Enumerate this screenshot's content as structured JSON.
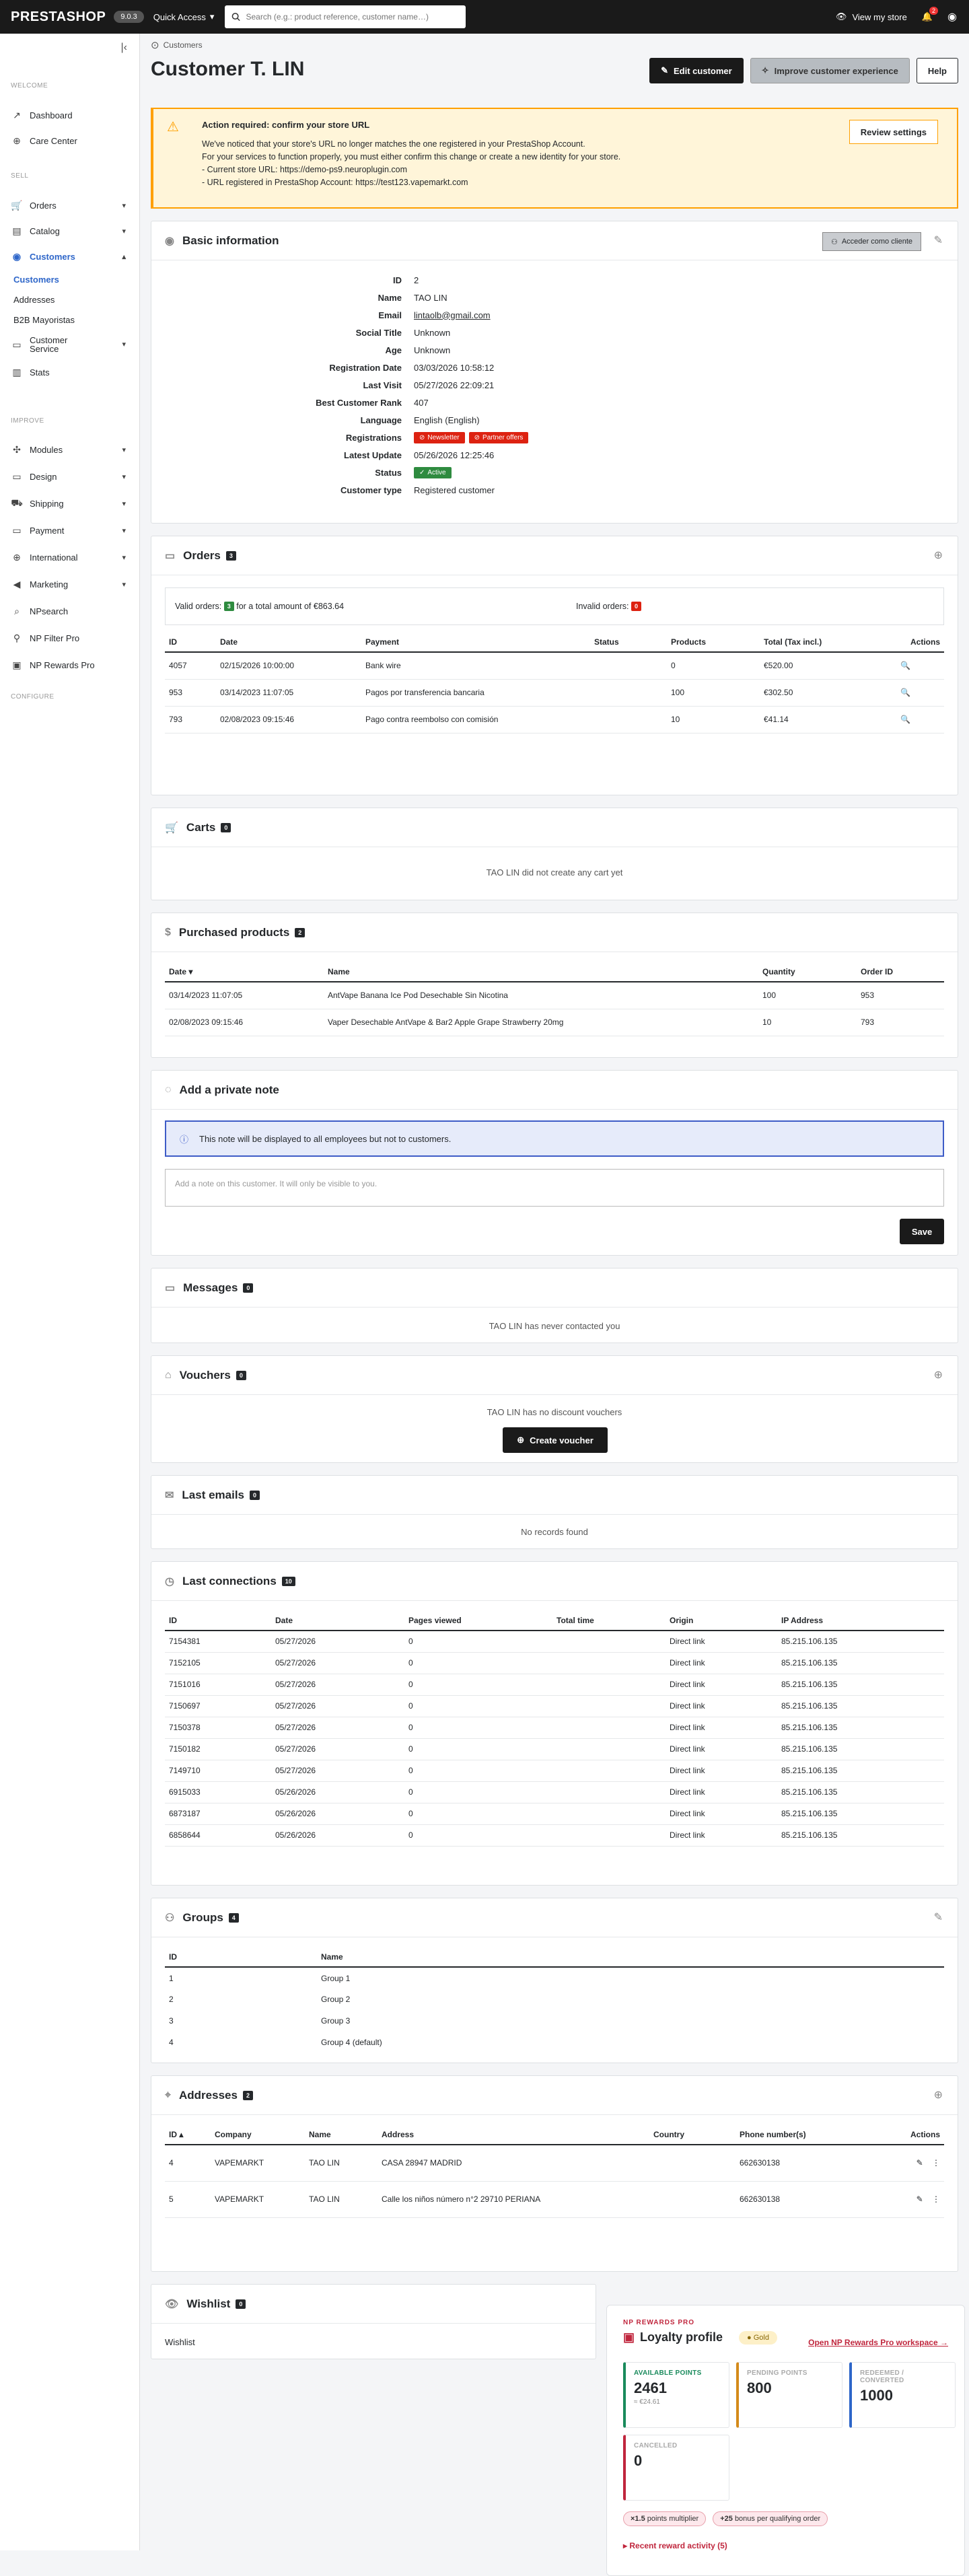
{
  "app": {
    "logo": "PRESTASHOP",
    "version": "9.0.3",
    "quick_access": "Quick Access",
    "search_placeholder": "Search (e.g.: product reference, customer name…)",
    "view_store": "View my store",
    "notif_count": "2"
  },
  "sidebar": {
    "sections": {
      "welcome": "WELCOME",
      "sell": "SELL",
      "improve": "IMPROVE",
      "configure": "CONFIGURE"
    },
    "welcome_items": [
      {
        "label": "Dashboard",
        "icon": "trend-icon"
      },
      {
        "label": "Care Center",
        "icon": "care-icon"
      }
    ],
    "sell_items": [
      {
        "label": "Orders"
      },
      {
        "label": "Catalog"
      },
      {
        "label": "Customers"
      }
    ],
    "customers_sub": [
      "Customers",
      "Addresses",
      "B2B Mayoristas"
    ],
    "sell_items2": [
      {
        "label": "Customer Service"
      },
      {
        "label": "Stats"
      }
    ],
    "improve_items": [
      {
        "label": "Modules"
      },
      {
        "label": "Design"
      },
      {
        "label": "Shipping"
      },
      {
        "label": "Payment"
      },
      {
        "label": "International"
      },
      {
        "label": "Marketing"
      },
      {
        "label": "NPsearch"
      },
      {
        "label": "NP Filter Pro"
      },
      {
        "label": "NP Rewards Pro"
      }
    ]
  },
  "header": {
    "breadcrumb": "Customers",
    "title": "Customer T. LIN",
    "edit": "Edit customer",
    "improve": "Improve customer experience",
    "help": "Help"
  },
  "alert": {
    "title": "Action required: confirm your store URL",
    "line1": "We've noticed that your store's URL no longer matches the one registered in your PrestaShop Account.",
    "line2": "For your services to function properly, you must either confirm this change or create a new identity for your store.",
    "line3": "- Current store URL: https://demo-ps9.neuroplugin.com",
    "line4": "- URL registered in PrestaShop Account: https://test123.vapemarkt.com",
    "button": "Review settings"
  },
  "basic": {
    "title": "Basic information",
    "acceder": "Acceder como cliente",
    "rows": [
      {
        "k": "ID",
        "v": "2"
      },
      {
        "k": "Name",
        "v": "TAO LIN"
      },
      {
        "k": "Email",
        "v": "lintaolb@gmail.com"
      },
      {
        "k": "Social Title",
        "v": "Unknown"
      },
      {
        "k": "Age",
        "v": "Unknown"
      },
      {
        "k": "Registration Date",
        "v": "03/03/2026 10:58:12"
      },
      {
        "k": "Last Visit",
        "v": "05/27/2026 22:09:21"
      },
      {
        "k": "Best Customer Rank",
        "v": "407"
      },
      {
        "k": "Language",
        "v": "English (English)"
      },
      {
        "k": "Registrations",
        "v": ""
      },
      {
        "k": "Latest Update",
        "v": "05/26/2026 12:25:46"
      },
      {
        "k": "Status",
        "v": ""
      },
      {
        "k": "Customer type",
        "v": "Registered customer"
      }
    ],
    "newsletter": "Newsletter",
    "partner": "Partner offers",
    "active": "Active"
  },
  "orders": {
    "title": "Orders",
    "count": "3",
    "valid_label": "Valid orders:",
    "valid_count": "3",
    "valid_text": "for a total amount of €863.64",
    "invalid_label": "Invalid orders:",
    "invalid_count": "0",
    "headers": [
      "ID",
      "Date",
      "Payment",
      "Status",
      "Products",
      "Total (Tax incl.)",
      "Actions"
    ],
    "rows": [
      [
        "4057",
        "02/15/2026 10:00:00",
        "Bank wire",
        "",
        "0",
        "€520.00"
      ],
      [
        "953",
        "03/14/2023 11:07:05",
        "Pagos por transferencia bancaria",
        "",
        "100",
        "€302.50"
      ],
      [
        "793",
        "02/08/2023 09:15:46",
        "Pago contra reembolso con comisión",
        "",
        "10",
        "€41.14"
      ]
    ]
  },
  "carts": {
    "title": "Carts",
    "count": "0",
    "empty": "TAO LIN did not create any cart yet"
  },
  "purchased": {
    "title": "Purchased products",
    "count": "2",
    "headers": [
      "Date",
      "Name",
      "Quantity",
      "Order ID"
    ],
    "rows": [
      [
        "03/14/2023 11:07:05",
        "AntVape Banana Ice Pod Desechable Sin Nicotina",
        "100",
        "953"
      ],
      [
        "02/08/2023 09:15:46",
        "Vaper Desechable AntVape & Bar2 Apple Grape Strawberry 20mg",
        "10",
        "793"
      ]
    ]
  },
  "note": {
    "title": "Add a private note",
    "info": "This note will be displayed to all employees but not to customers.",
    "placeholder": "Add a note on this customer. It will only be visible to you.",
    "save": "Save"
  },
  "messages": {
    "title": "Messages",
    "count": "0",
    "empty": "TAO LIN has never contacted you"
  },
  "vouchers": {
    "title": "Vouchers",
    "count": "0",
    "empty": "TAO LIN has no discount vouchers",
    "create": "Create voucher"
  },
  "emails": {
    "title": "Last emails",
    "count": "0",
    "empty": "No records found"
  },
  "connections": {
    "title": "Last connections",
    "count": "10",
    "headers": [
      "ID",
      "Date",
      "Pages viewed",
      "Total time",
      "Origin",
      "IP Address"
    ],
    "rows": [
      [
        "7154381",
        "05/27/2026",
        "0",
        "",
        "Direct link",
        "85.215.106.135"
      ],
      [
        "7152105",
        "05/27/2026",
        "0",
        "",
        "Direct link",
        "85.215.106.135"
      ],
      [
        "7151016",
        "05/27/2026",
        "0",
        "",
        "Direct link",
        "85.215.106.135"
      ],
      [
        "7150697",
        "05/27/2026",
        "0",
        "",
        "Direct link",
        "85.215.106.135"
      ],
      [
        "7150378",
        "05/27/2026",
        "0",
        "",
        "Direct link",
        "85.215.106.135"
      ],
      [
        "7150182",
        "05/27/2026",
        "0",
        "",
        "Direct link",
        "85.215.106.135"
      ],
      [
        "7149710",
        "05/27/2026",
        "0",
        "",
        "Direct link",
        "85.215.106.135"
      ],
      [
        "6915033",
        "05/26/2026",
        "0",
        "",
        "Direct link",
        "85.215.106.135"
      ],
      [
        "6873187",
        "05/26/2026",
        "0",
        "",
        "Direct link",
        "85.215.106.135"
      ],
      [
        "6858644",
        "05/26/2026",
        "0",
        "",
        "Direct link",
        "85.215.106.135"
      ]
    ]
  },
  "groups": {
    "title": "Groups",
    "count": "4",
    "headers": [
      "ID",
      "Name"
    ],
    "rows": [
      [
        "1",
        "Group 1"
      ],
      [
        "2",
        "Group 2"
      ],
      [
        "3",
        "Group 3"
      ],
      [
        "4",
        "Group 4 (default)"
      ]
    ]
  },
  "addresses": {
    "title": "Addresses",
    "count": "2",
    "headers": [
      "ID",
      "Company",
      "Name",
      "Address",
      "Country",
      "Phone number(s)",
      "Actions"
    ],
    "rows": [
      [
        "4",
        "VAPEMARKT",
        "TAO LIN",
        "CASA 28947 MADRID",
        "",
        "662630138"
      ],
      [
        "5",
        "VAPEMARKT",
        "TAO LIN",
        "Calle los niños número n°2 29710 PERIANA",
        "",
        "662630138"
      ]
    ]
  },
  "wishlist": {
    "title": "Wishlist",
    "count": "0",
    "label": "Wishlist"
  },
  "rewards": {
    "kicker": "NP REWARDS PRO",
    "title": "Loyalty profile",
    "tier": "Gold",
    "link": "Open NP Rewards Pro workspace →",
    "stats": [
      {
        "label": "AVAILABLE POINTS",
        "value": "2461",
        "sub": "≈ €24.61",
        "color": "#1a8a5c"
      },
      {
        "label": "PENDING POINTS",
        "value": "800",
        "sub": "",
        "color": "#d48a1a"
      },
      {
        "label": "REDEEMED / CONVERTED",
        "value": "1000",
        "sub": "",
        "color": "#2e66c9"
      },
      {
        "label": "CANCELLED",
        "value": "0",
        "sub": "",
        "color": "#c0263d"
      }
    ],
    "mult_value": "×1.5",
    "mult_text": "points multiplier",
    "bonus_value": "+25",
    "bonus_text": "bonus per qualifying order",
    "recent": "Recent reward activity (5)"
  }
}
